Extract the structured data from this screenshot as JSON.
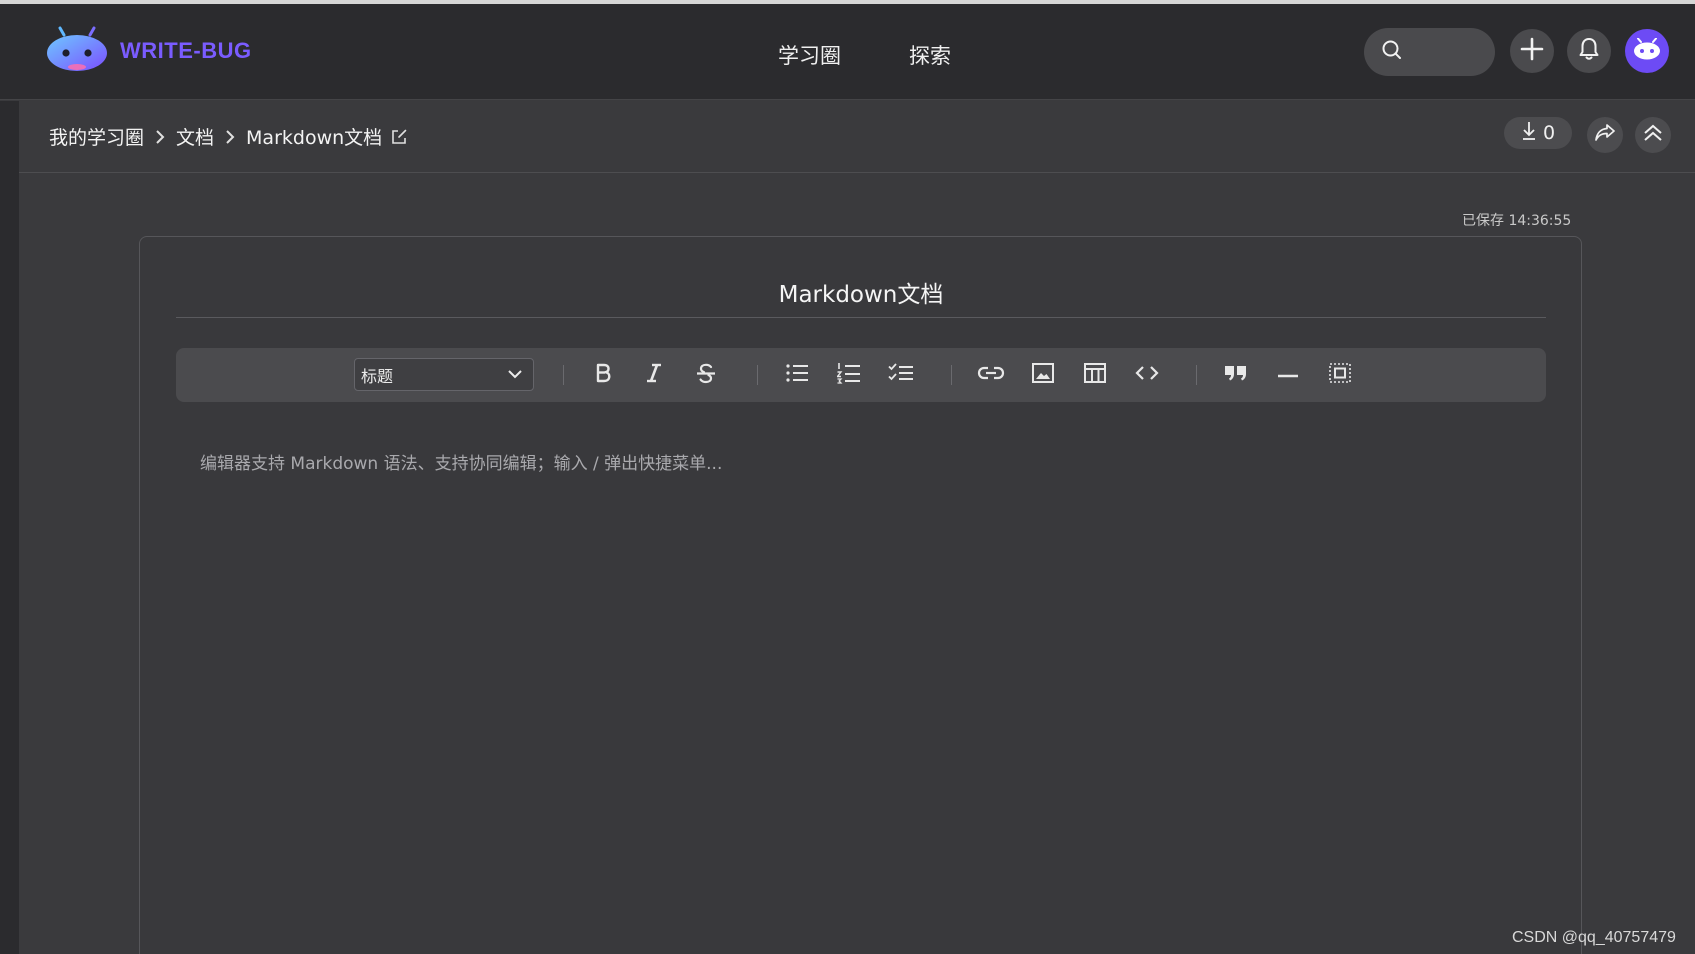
{
  "header": {
    "brand": "WRITE-BUG",
    "nav": [
      "学习圈",
      "探索"
    ],
    "icons": [
      "search-icon",
      "plus-icon",
      "bell-icon",
      "avatar-robot-icon"
    ],
    "accent": "#6d4bf5"
  },
  "breadcrumb": {
    "items": [
      "我的学习圈",
      "文档",
      "Markdown文档"
    ]
  },
  "actions": {
    "download_count": "0"
  },
  "editor": {
    "saved_status": "已保存 14:36:55",
    "title": "Markdown文档",
    "heading_select": "标题",
    "toolbar_icons": [
      "bold-icon",
      "italic-icon",
      "strikethrough-icon",
      "bullet-list-icon",
      "ordered-list-icon",
      "task-list-icon",
      "link-icon",
      "image-icon",
      "table-icon",
      "code-icon",
      "quote-icon",
      "horizontal-rule-icon",
      "code-block-icon"
    ],
    "placeholder": "编辑器支持 Markdown 语法、支持协同编辑；输入 / 弹出快捷菜单..."
  },
  "watermark": "CSDN @qq_40757479"
}
